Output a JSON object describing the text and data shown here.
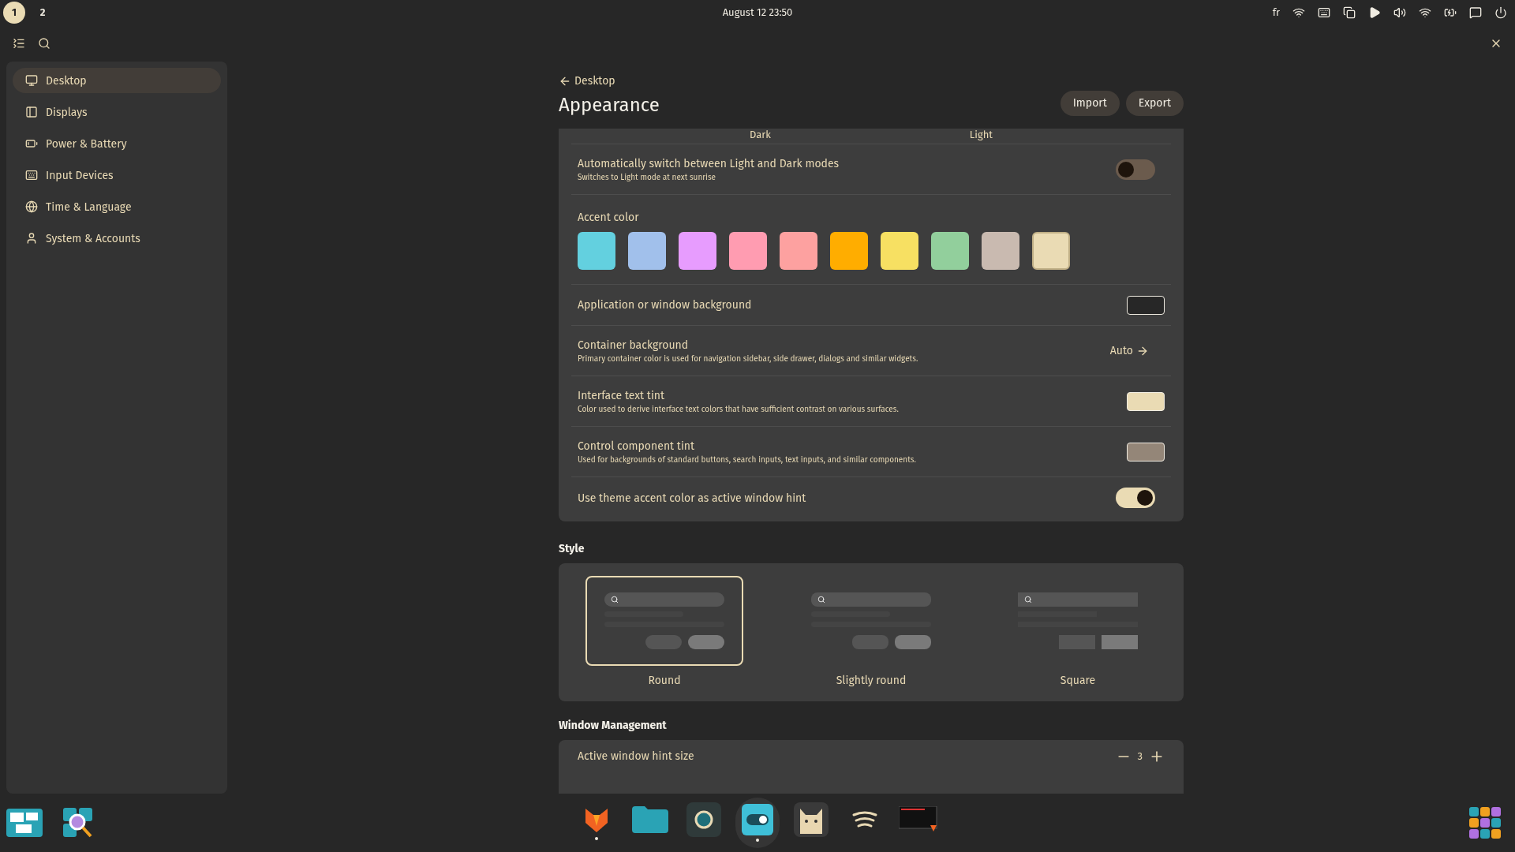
{
  "top_panel": {
    "workspaces": [
      {
        "label": "1",
        "selected": true
      },
      {
        "label": "2",
        "selected": false
      }
    ],
    "clock": "August 12 23:50",
    "keyboard_layout": "fr"
  },
  "sidebar": {
    "items": [
      {
        "label": "Desktop",
        "kind": "monitor",
        "selected": true
      },
      {
        "label": "Displays",
        "kind": "display",
        "selected": false
      },
      {
        "label": "Power & Battery",
        "kind": "battery",
        "selected": false
      },
      {
        "label": "Input Devices",
        "kind": "input",
        "selected": false
      },
      {
        "label": "Time & Language",
        "kind": "time",
        "selected": false
      },
      {
        "label": "System & Accounts",
        "kind": "user",
        "selected": false
      }
    ]
  },
  "page": {
    "back_label": "Desktop",
    "title": "Appearance",
    "buttons": [
      "Import",
      "Export"
    ]
  },
  "mode_labels": [
    "Dark",
    "Light"
  ],
  "settings": [
    {
      "kind": "toggle",
      "label": "Automatically switch between Light and Dark modes",
      "description": "Switches to Light mode at next sunrise",
      "on": false
    },
    {
      "kind": "accent",
      "label": "Accent color",
      "colors": [
        {
          "color": "#63d0df",
          "selected": false
        },
        {
          "color": "#a1c0eb",
          "selected": false
        },
        {
          "color": "#e79cfe",
          "selected": false
        },
        {
          "color": "#ff9cb1",
          "selected": false
        },
        {
          "color": "#fda1a0",
          "selected": false
        },
        {
          "color": "#ffad00",
          "selected": false
        },
        {
          "color": "#f7e062",
          "selected": false
        },
        {
          "color": "#92cf9c",
          "selected": false
        },
        {
          "color": "#c9bab0",
          "selected": false
        },
        {
          "color": "#eadbb4",
          "selected": true
        }
      ]
    },
    {
      "kind": "swatch",
      "label": "Application or window background",
      "color": "#272727"
    },
    {
      "kind": "link",
      "label": "Container background",
      "description": "Primary container color is used for navigation sidebar, side drawer, dialogs and similar widgets.",
      "value": "Auto"
    },
    {
      "kind": "swatch",
      "label": "Interface text tint",
      "description": "Color used to derive interface text colors that have sufficient contrast on various surfaces.",
      "color": "#eadbb4"
    },
    {
      "kind": "swatch",
      "label": "Control component tint",
      "description": "Used for backgrounds of standard buttons, search inputs, text inputs, and similar components.",
      "color": "#948678"
    },
    {
      "kind": "toggle",
      "label": "Use theme accent color as active window hint",
      "on": true
    }
  ],
  "style": {
    "title": "Style",
    "options": [
      {
        "label": "Round",
        "kind": "round",
        "selected": true
      },
      {
        "label": "Slightly round",
        "kind": "slight",
        "selected": false
      },
      {
        "label": "Square",
        "kind": "square",
        "selected": false
      }
    ]
  },
  "window_management": {
    "title": "Window Management",
    "rows": [
      {
        "label": "Active window hint size",
        "value": "3"
      }
    ]
  },
  "dock": {
    "left": [
      {
        "kind": "windows"
      },
      {
        "kind": "magnifier"
      }
    ],
    "apps": [
      {
        "kind": "fox",
        "running": true,
        "selected": false
      },
      {
        "kind": "folder",
        "running": false,
        "selected": false
      },
      {
        "kind": "ring",
        "running": false,
        "selected": false
      },
      {
        "kind": "toggle",
        "running": true,
        "selected": true
      },
      {
        "kind": "cat",
        "running": false,
        "selected": false
      },
      {
        "kind": "waves",
        "running": false,
        "selected": false
      },
      {
        "kind": "terminal",
        "running": false,
        "selected": false
      }
    ]
  }
}
